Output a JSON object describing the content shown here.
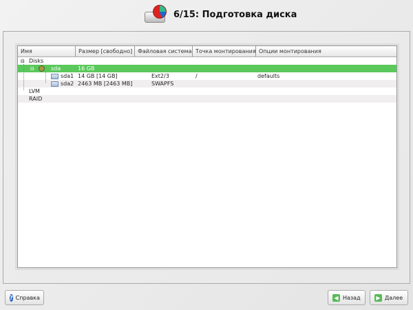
{
  "header": {
    "title": "6/15: Подготовка диска"
  },
  "table": {
    "columns": [
      "Имя",
      "Размер [свободно]",
      "Файловая система",
      "Точка монтирования",
      "Опции монтирования"
    ],
    "rows": [
      {
        "name": "Disks",
        "size": "",
        "fs": "",
        "mount": "",
        "options": ""
      },
      {
        "name": "sda",
        "size": "16 GB",
        "fs": "",
        "mount": "",
        "options": ""
      },
      {
        "name": "sda1",
        "size": "14 GB [14 GB]",
        "fs": "Ext2/3",
        "mount": "/",
        "options": "defaults"
      },
      {
        "name": "sda2",
        "size": "2463 MB [2463 MB]",
        "fs": "SWAPFS",
        "mount": "",
        "options": ""
      },
      {
        "name": "LVM",
        "size": "",
        "fs": "",
        "mount": "",
        "options": ""
      },
      {
        "name": "RAID",
        "size": "",
        "fs": "",
        "mount": "",
        "options": ""
      }
    ]
  },
  "buttons": {
    "help": "Справка",
    "back": "Назад",
    "next": "Далее"
  },
  "colors": {
    "selection": "#5ac85a"
  }
}
